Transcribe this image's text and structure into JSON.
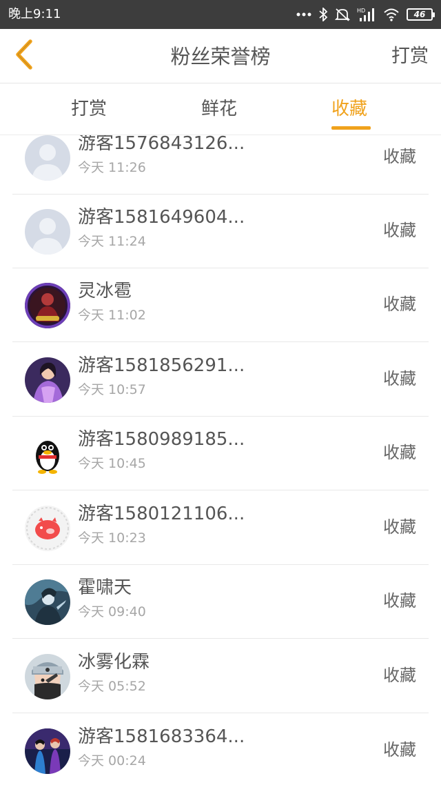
{
  "status_bar": {
    "time": "晚上9:11",
    "battery": "46",
    "icons": [
      "dots-icon",
      "bluetooth-icon",
      "mute-icon",
      "hd-signal-icon",
      "wifi-icon",
      "battery-icon"
    ]
  },
  "header": {
    "title": "粉丝荣誉榜",
    "action": "打赏",
    "back_icon": "chevron-left-icon"
  },
  "tabs": [
    {
      "label": "打赏",
      "active": false
    },
    {
      "label": "鲜花",
      "active": false
    },
    {
      "label": "收藏",
      "active": true
    }
  ],
  "colors": {
    "accent": "#f0a21c",
    "status_bar": "#3d3d3d",
    "text": "#555555",
    "subtext": "#a6a6a6"
  },
  "fans": [
    {
      "name": "游客1576843126...",
      "time": "今天 11:26",
      "action": "收藏",
      "avatar": "default-avatar"
    },
    {
      "name": "游客1581649604...",
      "time": "今天 11:24",
      "action": "收藏",
      "avatar": "default-avatar"
    },
    {
      "name": "灵冰雹",
      "time": "今天 11:02",
      "action": "收藏",
      "avatar": "game-character-avatar"
    },
    {
      "name": "游客1581856291...",
      "time": "今天 10:57",
      "action": "收藏",
      "avatar": "purple-lady-avatar"
    },
    {
      "name": "游客1580989185...",
      "time": "今天 10:45",
      "action": "收藏",
      "avatar": "qq-penguin-avatar"
    },
    {
      "name": "游客1580121106...",
      "time": "今天 10:23",
      "action": "收藏",
      "avatar": "red-pig-avatar"
    },
    {
      "name": "霍啸天",
      "time": "今天 09:40",
      "action": "收藏",
      "avatar": "ice-warrior-avatar"
    },
    {
      "name": "冰雾化霖",
      "time": "今天 05:52",
      "action": "收藏",
      "avatar": "ninja-avatar"
    },
    {
      "name": "游客1581683364...",
      "time": "今天 00:24",
      "action": "收藏",
      "avatar": "anime-duo-avatar"
    }
  ]
}
